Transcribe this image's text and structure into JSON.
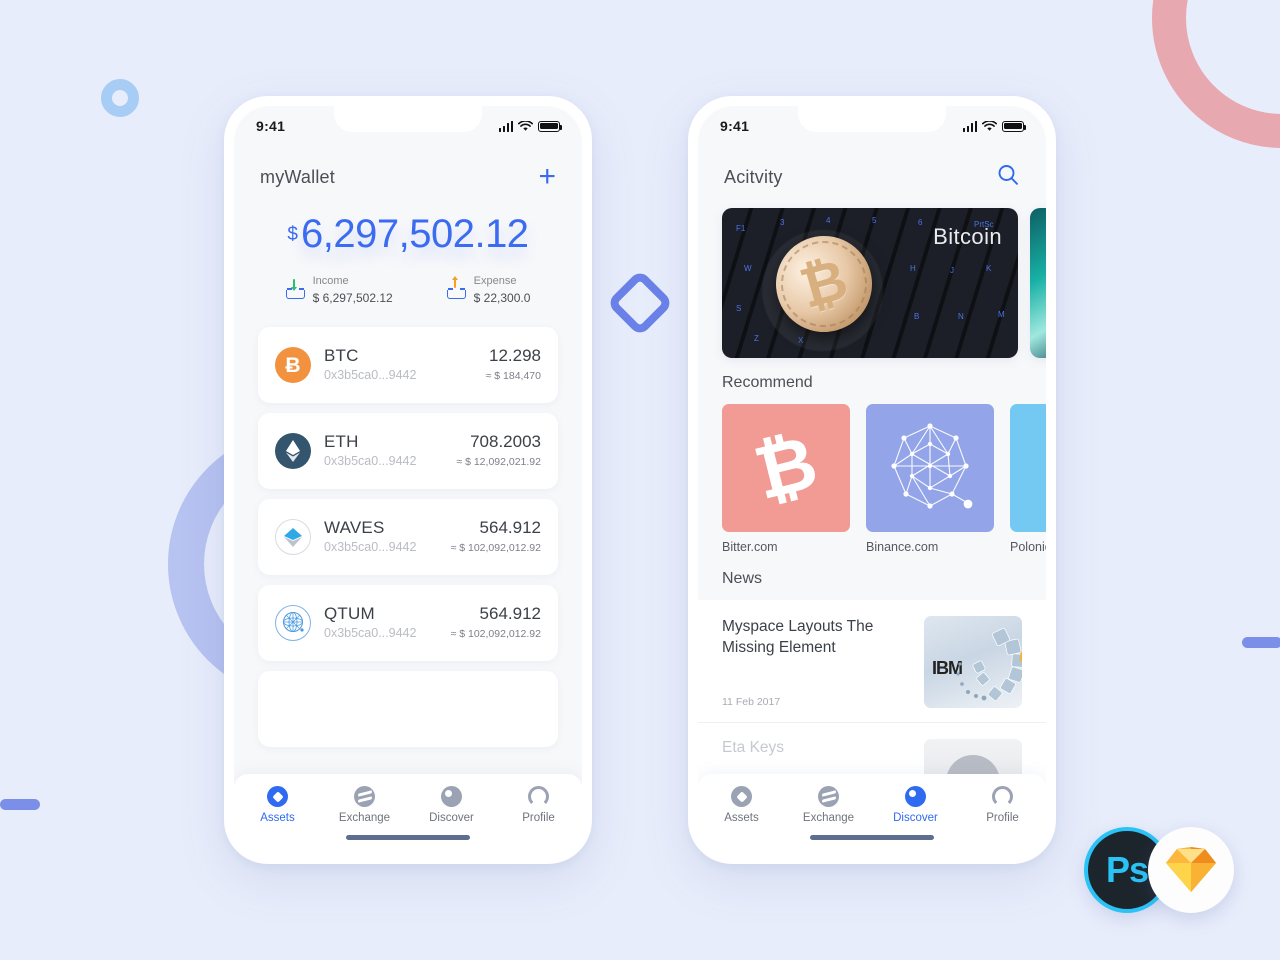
{
  "background": {
    "color": "#e8edfb",
    "decorations": [
      {
        "name": "ring-pink",
        "color": "#e8a8b0"
      },
      {
        "name": "ring-periwinkle",
        "color": "#aebbee"
      },
      {
        "name": "ring-lightblue",
        "color": "#a7cdf5"
      },
      {
        "name": "bar-left",
        "color": "#7b8fe8"
      },
      {
        "name": "bar-right",
        "color": "#7b8fe8"
      },
      {
        "name": "diamond-outline",
        "color": "#6b82e8"
      }
    ]
  },
  "accent": "#3a6bf0",
  "statusbar": {
    "time": "9:41",
    "icons": [
      "signal-icon",
      "wifi-icon",
      "battery-icon"
    ]
  },
  "wallet": {
    "header": {
      "title": "myWallet",
      "add_label": "+"
    },
    "balance": {
      "currency": "$",
      "amount": "6,297,502.12"
    },
    "income": {
      "label": "Income",
      "value": "$ 6,297,502.12"
    },
    "expense": {
      "label": "Expense",
      "value": "$ 22,300.0"
    },
    "assets": [
      {
        "symbol": "BTC",
        "address": "0x3b5ca0...9442",
        "quantity": "12.298",
        "usd": "≈ $ 184,470",
        "icon": "bitcoin-icon",
        "color": "#f2913e",
        "glyph": "Ƀ"
      },
      {
        "symbol": "ETH",
        "address": "0x3b5ca0...9442",
        "quantity": "708.2003",
        "usd": "≈ $ 12,092,021.92",
        "icon": "ethereum-icon",
        "color": "#34556e",
        "glyph": "◆"
      },
      {
        "symbol": "WAVES",
        "address": "0x3b5ca0...9442",
        "quantity": "564.912",
        "usd": "≈ $ 102,092,012.92",
        "icon": "waves-icon",
        "color": "#2fa8e8",
        "glyph": ""
      },
      {
        "symbol": "QTUM",
        "address": "0x3b5ca0...9442",
        "quantity": "564.912",
        "usd": "≈ $ 102,092,012.92",
        "icon": "qtum-icon",
        "color": "#4a9ae0",
        "glyph": ""
      }
    ]
  },
  "discover": {
    "header": {
      "title": "Acitvity",
      "search": "search-icon"
    },
    "banners": [
      {
        "label": "Bitcoin",
        "name": "bitcoin-keyboard-banner"
      },
      {
        "label": "",
        "name": "teal-abstract-banner"
      }
    ],
    "recommend": {
      "title": "Recommend",
      "items": [
        {
          "name": "Bitter.com",
          "color": "#f29a94",
          "icon": "bitcoin-glyph"
        },
        {
          "name": "Binance.com",
          "color": "#93a5e8",
          "icon": "network-graph-icon"
        },
        {
          "name": "Polonie",
          "color": "#74c9f2",
          "icon": ""
        }
      ]
    },
    "news": {
      "title": "News",
      "items": [
        {
          "title": "Myspace Layouts The Missing Element",
          "date": "11 Feb 2017",
          "thumb": "ibm-rings-image"
        },
        {
          "title": "Eta Keys",
          "date": "",
          "thumb": "portrait-image"
        }
      ]
    }
  },
  "tabbar": {
    "items": [
      {
        "label": "Assets",
        "icon": "assets-icon"
      },
      {
        "label": "Exchange",
        "icon": "exchange-icon"
      },
      {
        "label": "Discover",
        "icon": "discover-icon"
      },
      {
        "label": "Profile",
        "icon": "profile-icon"
      }
    ]
  },
  "logos": {
    "photoshop": {
      "text": "Ps",
      "ring": "#2ac3f5",
      "bg": "#1d252c"
    },
    "sketch": {
      "text": "",
      "gem_colors": [
        "#f5a623",
        "#ffd24a",
        "#f78f1e"
      ]
    }
  }
}
